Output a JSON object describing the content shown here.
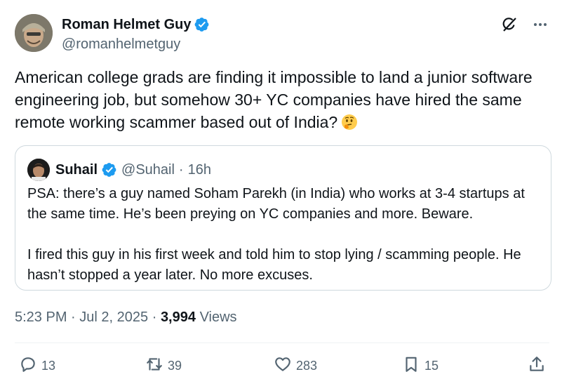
{
  "author": {
    "name": "Roman Helmet Guy",
    "handle": "@romanhelmetguy"
  },
  "tweet": {
    "text": "American college grads are finding it impossible to land a junior software engineering job, but somehow 30+ YC companies have hired the same remote working scammer based out of India?",
    "emoji": "thinking-face"
  },
  "quoted": {
    "name": "Suhail",
    "handle": "@Suhail",
    "separator": "·",
    "age": "16h",
    "paragraph1": "PSA: there’s a guy named Soham Parekh (in India) who works at 3-4 startups at the same time. He’s been preying on YC companies and more. Beware.",
    "paragraph2": "I fired this guy in his first week and told him to stop lying / scamming people. He hasn’t stopped a year later. No more excuses."
  },
  "meta": {
    "time": "5:23 PM",
    "sep1": "·",
    "date": "Jul 2, 2025",
    "sep2": "·",
    "views_count": "3,994",
    "views_label": "Views"
  },
  "actions": {
    "replies": "13",
    "reposts": "39",
    "likes": "283",
    "bookmarks": "15"
  },
  "colors": {
    "verified": "#1d9bf0",
    "secondary_text": "#536471",
    "primary_text": "#0f1419",
    "border": "#cfd9de"
  },
  "icons": [
    "verified-badge-icon",
    "grok-icon",
    "more-icon",
    "reply-icon",
    "repost-icon",
    "like-icon",
    "bookmark-icon",
    "share-icon"
  ]
}
